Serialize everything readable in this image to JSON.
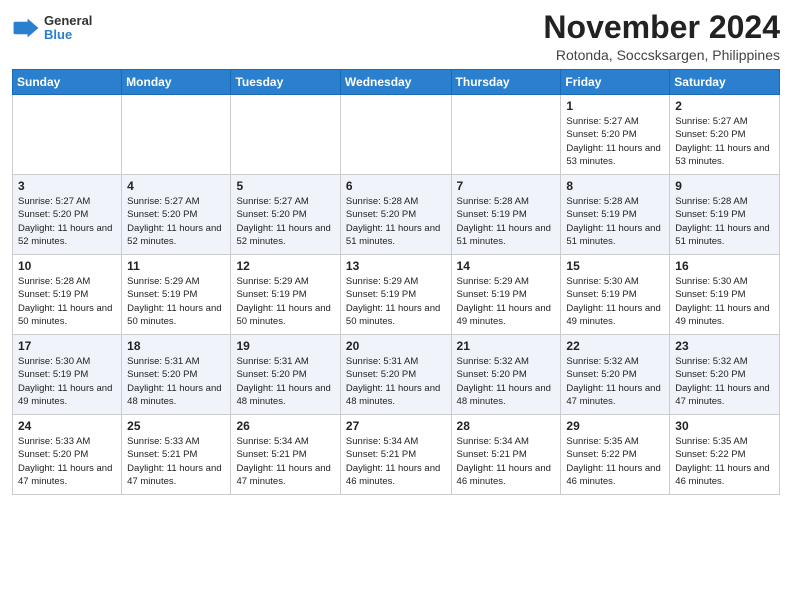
{
  "header": {
    "logo_line1": "General",
    "logo_line2": "Blue",
    "month_title": "November 2024",
    "location": "Rotonda, Soccsksargen, Philippines"
  },
  "weekdays": [
    "Sunday",
    "Monday",
    "Tuesday",
    "Wednesday",
    "Thursday",
    "Friday",
    "Saturday"
  ],
  "weeks": [
    [
      {
        "day": "",
        "sunrise": "",
        "sunset": "",
        "daylight": ""
      },
      {
        "day": "",
        "sunrise": "",
        "sunset": "",
        "daylight": ""
      },
      {
        "day": "",
        "sunrise": "",
        "sunset": "",
        "daylight": ""
      },
      {
        "day": "",
        "sunrise": "",
        "sunset": "",
        "daylight": ""
      },
      {
        "day": "",
        "sunrise": "",
        "sunset": "",
        "daylight": ""
      },
      {
        "day": "1",
        "sunrise": "5:27 AM",
        "sunset": "5:20 PM",
        "daylight": "11 hours and 53 minutes."
      },
      {
        "day": "2",
        "sunrise": "5:27 AM",
        "sunset": "5:20 PM",
        "daylight": "11 hours and 53 minutes."
      }
    ],
    [
      {
        "day": "3",
        "sunrise": "5:27 AM",
        "sunset": "5:20 PM",
        "daylight": "11 hours and 52 minutes."
      },
      {
        "day": "4",
        "sunrise": "5:27 AM",
        "sunset": "5:20 PM",
        "daylight": "11 hours and 52 minutes."
      },
      {
        "day": "5",
        "sunrise": "5:27 AM",
        "sunset": "5:20 PM",
        "daylight": "11 hours and 52 minutes."
      },
      {
        "day": "6",
        "sunrise": "5:28 AM",
        "sunset": "5:20 PM",
        "daylight": "11 hours and 51 minutes."
      },
      {
        "day": "7",
        "sunrise": "5:28 AM",
        "sunset": "5:19 PM",
        "daylight": "11 hours and 51 minutes."
      },
      {
        "day": "8",
        "sunrise": "5:28 AM",
        "sunset": "5:19 PM",
        "daylight": "11 hours and 51 minutes."
      },
      {
        "day": "9",
        "sunrise": "5:28 AM",
        "sunset": "5:19 PM",
        "daylight": "11 hours and 51 minutes."
      }
    ],
    [
      {
        "day": "10",
        "sunrise": "5:28 AM",
        "sunset": "5:19 PM",
        "daylight": "11 hours and 50 minutes."
      },
      {
        "day": "11",
        "sunrise": "5:29 AM",
        "sunset": "5:19 PM",
        "daylight": "11 hours and 50 minutes."
      },
      {
        "day": "12",
        "sunrise": "5:29 AM",
        "sunset": "5:19 PM",
        "daylight": "11 hours and 50 minutes."
      },
      {
        "day": "13",
        "sunrise": "5:29 AM",
        "sunset": "5:19 PM",
        "daylight": "11 hours and 50 minutes."
      },
      {
        "day": "14",
        "sunrise": "5:29 AM",
        "sunset": "5:19 PM",
        "daylight": "11 hours and 49 minutes."
      },
      {
        "day": "15",
        "sunrise": "5:30 AM",
        "sunset": "5:19 PM",
        "daylight": "11 hours and 49 minutes."
      },
      {
        "day": "16",
        "sunrise": "5:30 AM",
        "sunset": "5:19 PM",
        "daylight": "11 hours and 49 minutes."
      }
    ],
    [
      {
        "day": "17",
        "sunrise": "5:30 AM",
        "sunset": "5:19 PM",
        "daylight": "11 hours and 49 minutes."
      },
      {
        "day": "18",
        "sunrise": "5:31 AM",
        "sunset": "5:20 PM",
        "daylight": "11 hours and 48 minutes."
      },
      {
        "day": "19",
        "sunrise": "5:31 AM",
        "sunset": "5:20 PM",
        "daylight": "11 hours and 48 minutes."
      },
      {
        "day": "20",
        "sunrise": "5:31 AM",
        "sunset": "5:20 PM",
        "daylight": "11 hours and 48 minutes."
      },
      {
        "day": "21",
        "sunrise": "5:32 AM",
        "sunset": "5:20 PM",
        "daylight": "11 hours and 48 minutes."
      },
      {
        "day": "22",
        "sunrise": "5:32 AM",
        "sunset": "5:20 PM",
        "daylight": "11 hours and 47 minutes."
      },
      {
        "day": "23",
        "sunrise": "5:32 AM",
        "sunset": "5:20 PM",
        "daylight": "11 hours and 47 minutes."
      }
    ],
    [
      {
        "day": "24",
        "sunrise": "5:33 AM",
        "sunset": "5:20 PM",
        "daylight": "11 hours and 47 minutes."
      },
      {
        "day": "25",
        "sunrise": "5:33 AM",
        "sunset": "5:21 PM",
        "daylight": "11 hours and 47 minutes."
      },
      {
        "day": "26",
        "sunrise": "5:34 AM",
        "sunset": "5:21 PM",
        "daylight": "11 hours and 47 minutes."
      },
      {
        "day": "27",
        "sunrise": "5:34 AM",
        "sunset": "5:21 PM",
        "daylight": "11 hours and 46 minutes."
      },
      {
        "day": "28",
        "sunrise": "5:34 AM",
        "sunset": "5:21 PM",
        "daylight": "11 hours and 46 minutes."
      },
      {
        "day": "29",
        "sunrise": "5:35 AM",
        "sunset": "5:22 PM",
        "daylight": "11 hours and 46 minutes."
      },
      {
        "day": "30",
        "sunrise": "5:35 AM",
        "sunset": "5:22 PM",
        "daylight": "11 hours and 46 minutes."
      }
    ]
  ],
  "labels": {
    "sunrise": "Sunrise:",
    "sunset": "Sunset:",
    "daylight": "Daylight:"
  }
}
